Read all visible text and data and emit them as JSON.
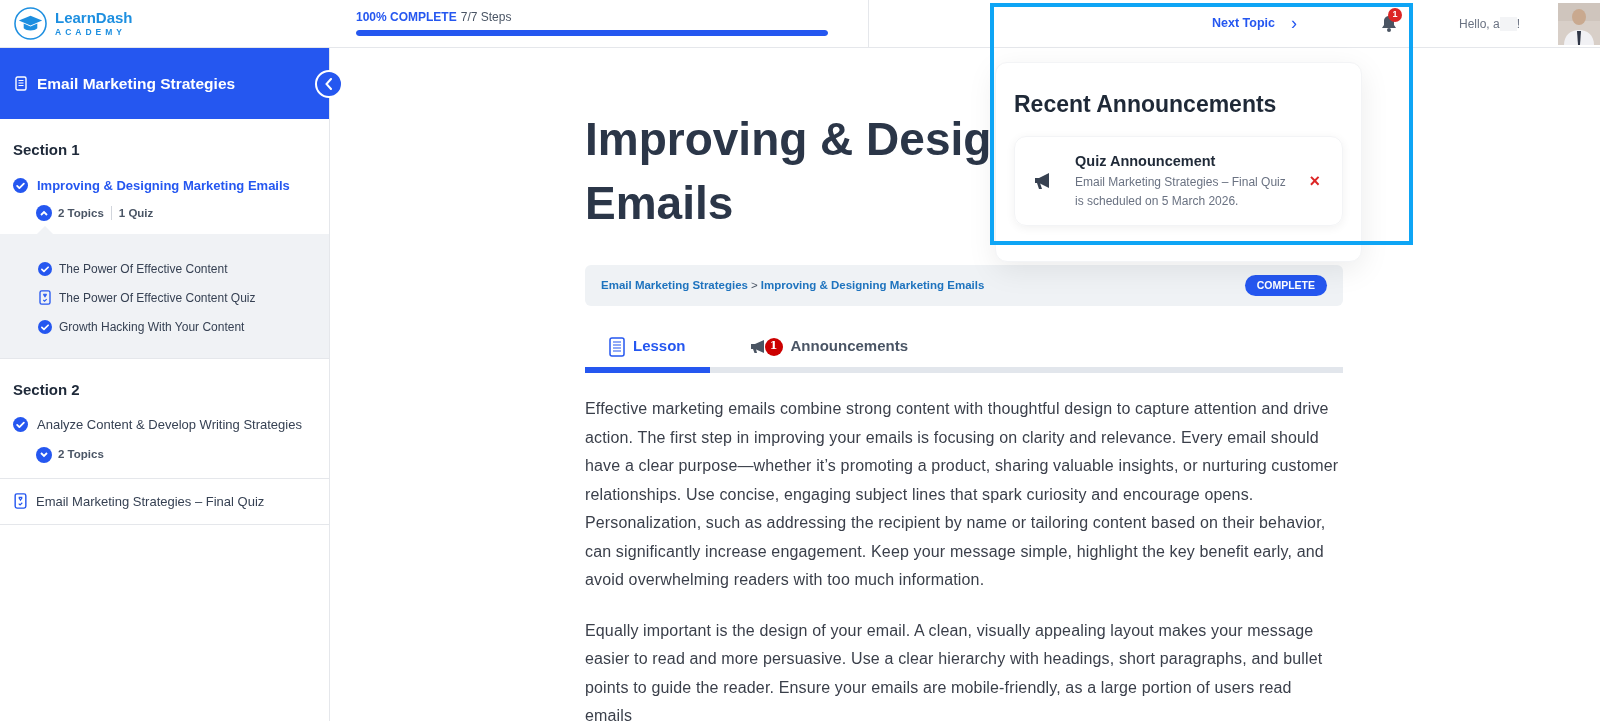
{
  "logo": {
    "name": "LearnDash",
    "tagline": "ACADEMY"
  },
  "progress": {
    "label": "100% COMPLETE",
    "steps": "7/7 Steps",
    "level": 1
  },
  "header": {
    "next_topic": "Next Topic",
    "next_icon": "›",
    "notification_count": "1",
    "greeting": "Hello, a",
    "greeting_end": "!"
  },
  "sidebar": {
    "course_title": "Email Marketing Strategies",
    "sections": [
      {
        "title": "Section 1",
        "lessons": [
          {
            "title": "Improving & Designing Marketing Emails",
            "completed": true,
            "selected": true,
            "expanded": true,
            "counts": [
              "2 Topics",
              "1 Quiz"
            ],
            "children": [
              {
                "kind": "topic",
                "title": "The Power Of Effective Content"
              },
              {
                "kind": "quiz",
                "title": "The Power Of Effective Content Quiz"
              },
              {
                "kind": "topic",
                "title": "Growth Hacking With Your Content"
              }
            ]
          }
        ]
      },
      {
        "title": "Section 2",
        "lessons": [
          {
            "title": "Analyze Content & Develop Writing Strategies",
            "completed": true,
            "selected": false,
            "expanded": false,
            "counts": [
              "2 Topics"
            ]
          }
        ]
      }
    ],
    "final_quiz": "Email Marketing Strategies – Final Quiz"
  },
  "lesson": {
    "title_lines": [
      "Improving & Desig",
      "Emails"
    ],
    "breadcrumb": [
      "Email Marketing Strategies",
      "Improving & Designing Marketing Emails"
    ],
    "breadcrumb_separator": ">",
    "status": "COMPLETE",
    "tabs": [
      {
        "label": "Lesson",
        "kind": "lesson",
        "selected": true
      },
      {
        "label": "Announcements",
        "kind": "announcements",
        "selected": false,
        "badge": "1"
      }
    ],
    "paragraphs": [
      "Effective marketing emails combine strong content with thoughtful design to capture attention and drive action. The first step in improving your emails is focusing on clarity and relevance. Every email should have a clear purpose—whether it’s promoting a product, sharing valuable insights, or nurturing customer relationships. Use concise, engaging subject lines that spark curiosity and encourage opens. Personalization, such as addressing the recipient by name or tailoring content based on their behavior, can significantly increase engagement. Keep your message simple, highlight the key benefit early, and avoid overwhelming readers with too much information.",
      "Equally important is the design of your email. A clean, visually appealing layout makes your message easier to read and more persuasive. Use a clear hierarchy with headings, short paragraphs, and bullet points to guide the reader. Ensure your emails are mobile-friendly, as a large portion of users read emails"
    ]
  },
  "announcements_popup": {
    "title": "Recent Announcements",
    "items": [
      {
        "title": "Quiz Announcement",
        "body": "Email Marketing Strategies – Final Quiz is scheduled on 5 March 2026.",
        "dismiss": "×"
      }
    ]
  }
}
